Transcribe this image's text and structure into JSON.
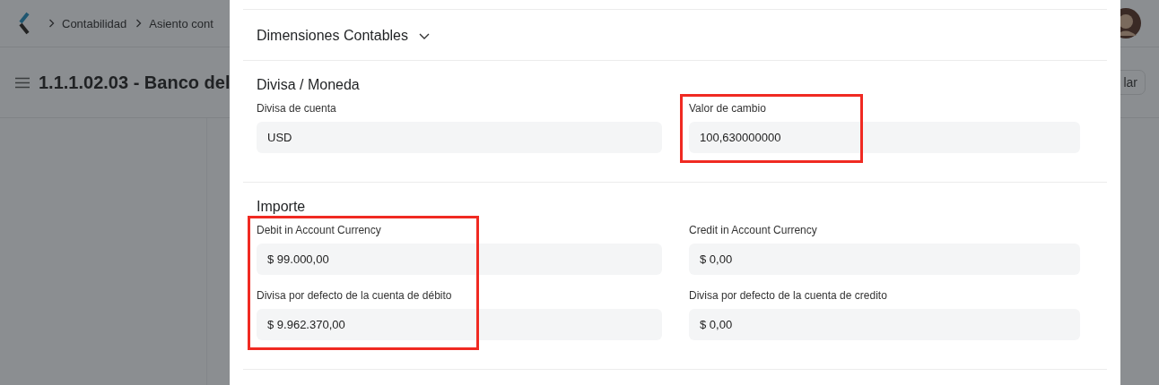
{
  "page": {
    "breadcrumbs": [
      {
        "label": "Contabilidad"
      },
      {
        "label": "Asiento cont"
      }
    ],
    "title": "1.1.1.02.03 - Banco del",
    "button": "lar"
  },
  "dialog": {
    "collapsed_section": {
      "title": "Dimensiones Contables",
      "expanded": false
    },
    "sections": [
      {
        "title": "Divisa / Moneda",
        "columns": [
          {
            "highlighted": false,
            "fields": [
              {
                "label": "Divisa de cuenta",
                "value": "USD"
              }
            ]
          },
          {
            "highlighted": true,
            "fields": [
              {
                "label": "Valor de cambio",
                "value": "100,630000000"
              }
            ]
          }
        ]
      },
      {
        "title": "Importe",
        "columns": [
          {
            "highlighted": true,
            "fields": [
              {
                "label": "Debit in Account Currency",
                "value": "$ 99.000,00"
              },
              {
                "label": "Divisa por defecto de la cuenta de débito",
                "value": "$ 9.962.370,00"
              }
            ]
          },
          {
            "highlighted": false,
            "fields": [
              {
                "label": "Credit in Account Currency",
                "value": "$ 0,00"
              },
              {
                "label": "Divisa por defecto de la cuenta de credito",
                "value": "$ 0,00"
              }
            ]
          }
        ]
      }
    ]
  }
}
